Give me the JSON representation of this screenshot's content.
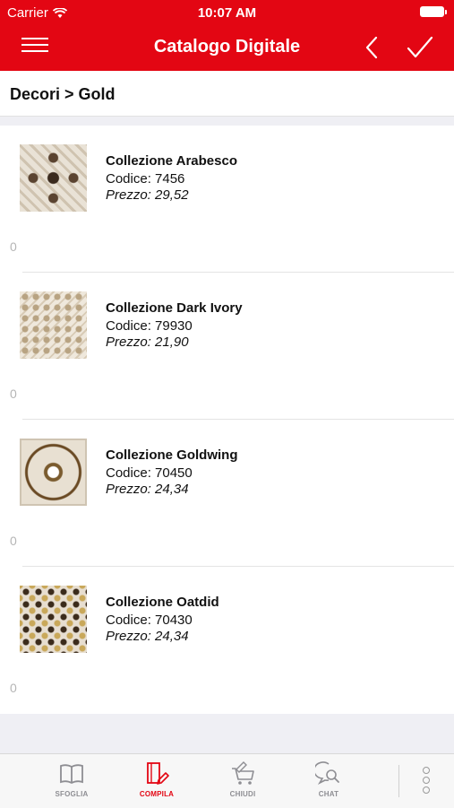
{
  "status_bar": {
    "carrier": "Carrier",
    "time": "10:07 AM"
  },
  "nav": {
    "title": "Catalogo Digitale"
  },
  "breadcrumb": "Decori > Gold",
  "products": [
    {
      "name": "Collezione Arabesco",
      "code": "Codice: 7456",
      "price": "Prezzo: 29,52",
      "qty": "0"
    },
    {
      "name": "Collezione Dark Ivory",
      "code": "Codice: 79930",
      "price": "Prezzo: 21,90",
      "qty": "0"
    },
    {
      "name": "Collezione Goldwing",
      "code": "Codice: 70450",
      "price": "Prezzo: 24,34",
      "qty": "0"
    },
    {
      "name": "Collezione Oatdid",
      "code": "Codice: 70430",
      "price": "Prezzo: 24,34",
      "qty": "0"
    }
  ],
  "tabs": [
    {
      "label": "SFOGLIA",
      "icon": "book-icon",
      "active": false
    },
    {
      "label": "COMPILA",
      "icon": "edit-document-icon",
      "active": true
    },
    {
      "label": "CHIUDI",
      "icon": "cart-edit-icon",
      "active": false
    },
    {
      "label": "CHAT",
      "icon": "chat-search-icon",
      "active": false
    }
  ],
  "colors": {
    "accent": "#e30613",
    "tab_inactive": "#8e8e93",
    "background_band": "#efeff4"
  }
}
